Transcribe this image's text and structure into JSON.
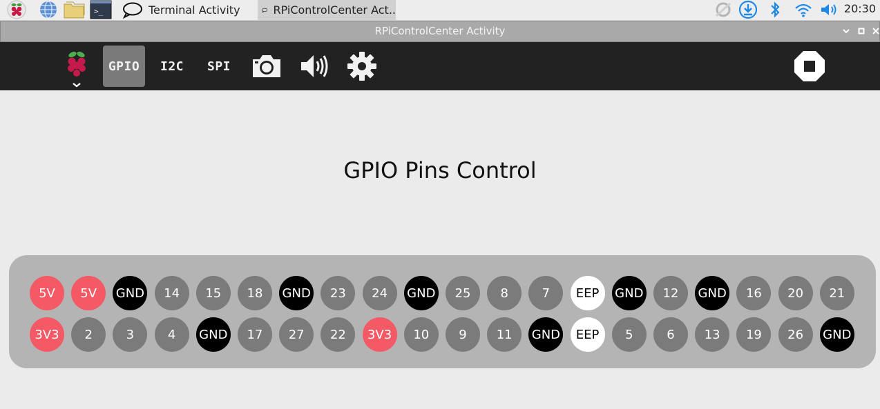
{
  "taskbar": {
    "tasks": [
      {
        "label": "Terminal Activity",
        "active": false
      },
      {
        "label": "RPiControlCenter Act..",
        "active": true
      }
    ],
    "clock": "20:30",
    "launchers": [
      "raspberry-menu-icon",
      "web-browser-icon",
      "file-manager-icon",
      "terminal-icon"
    ],
    "tray": [
      "sync-icon",
      "download-icon",
      "bluetooth-icon",
      "wifi-icon",
      "volume-icon"
    ]
  },
  "window": {
    "title": "RPiControlCenter Activity"
  },
  "toolbar": {
    "items": [
      {
        "label": "GPIO",
        "selected": true
      },
      {
        "label": "I2C",
        "selected": false
      },
      {
        "label": "SPI",
        "selected": false
      }
    ],
    "icons": [
      "raspberry-icon",
      "camera-icon",
      "speaker-icon",
      "settings-icon",
      "stop-icon"
    ]
  },
  "content": {
    "heading": "GPIO Pins Control"
  },
  "pins": {
    "top_row": [
      "5V",
      "5V",
      "GND",
      "14",
      "15",
      "18",
      "GND",
      "23",
      "24",
      "GND",
      "25",
      "8",
      "7",
      "EEP",
      "GND",
      "12",
      "GND",
      "16",
      "20",
      "21"
    ],
    "bottom_row": [
      "3V3",
      "2",
      "3",
      "4",
      "GND",
      "17",
      "27",
      "22",
      "3V3",
      "10",
      "9",
      "11",
      "GND",
      "EEP",
      "5",
      "6",
      "13",
      "19",
      "26",
      "GND"
    ]
  },
  "colors": {
    "power": "#f45a66",
    "ground": "#000000",
    "gpio": "#7b7b7b",
    "eeprom": "#ffffff",
    "toolbar": "#222222",
    "accent_blue": "#1e88e5"
  }
}
